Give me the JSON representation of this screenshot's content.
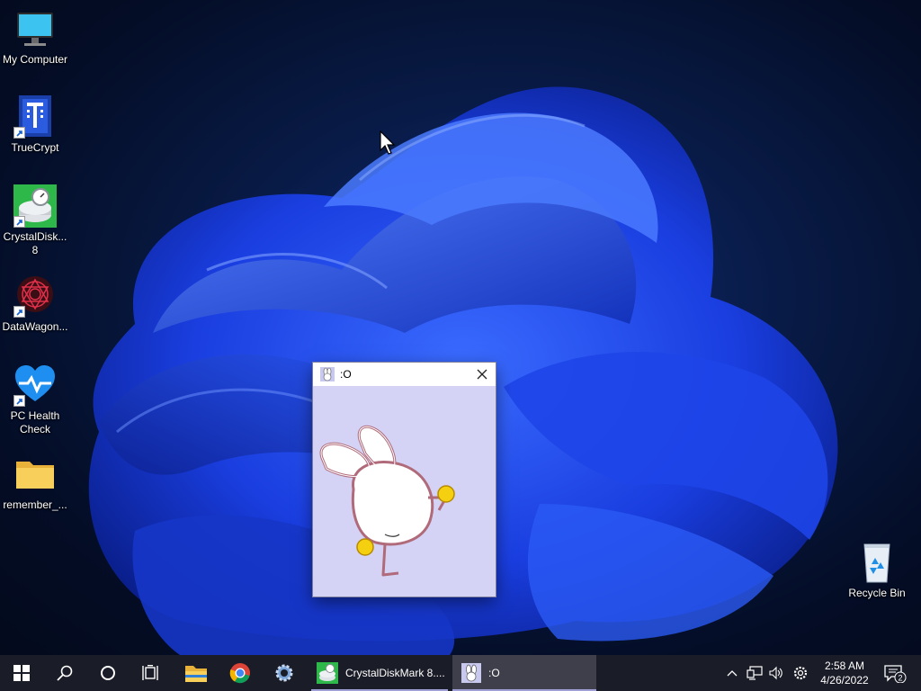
{
  "desktop": {
    "icons": [
      {
        "label": "My Computer",
        "icon": "monitor-icon"
      },
      {
        "label": "TrueCrypt",
        "icon": "truecrypt-icon"
      },
      {
        "label": "CrystalDisk... 8",
        "icon": "crystaldiskmark-icon"
      },
      {
        "label": "DataWagon...",
        "icon": "datawagon-icon"
      },
      {
        "label": "PC Health Check",
        "icon": "pc-health-icon"
      },
      {
        "label": "remember_...",
        "icon": "folder-icon"
      },
      {
        "label": "Recycle Bin",
        "icon": "recycle-bin-icon"
      }
    ]
  },
  "popup": {
    "title": ":O",
    "background_color": "#d4d3f5"
  },
  "taskbar": {
    "pinned": [
      "start-icon",
      "search-icon",
      "cortana-icon",
      "task-view-icon",
      "file-explorer-icon",
      "chrome-icon",
      "settings-gear-icon"
    ],
    "tasks": [
      {
        "label": "CrystalDiskMark 8....",
        "icon": "crystaldiskmark-icon"
      },
      {
        "label": ":O",
        "icon": "bunny-icon"
      }
    ],
    "tray": [
      "chevron-up-icon",
      "network-icon",
      "volume-icon",
      "gear-icon"
    ],
    "clock": {
      "time": "2:58 AM",
      "date": "4/26/2022"
    },
    "notification_count": "2"
  },
  "colors": {
    "taskbar_bg": "#1a1c27",
    "accent": "#9f9fd6",
    "wallpaper_blue": "#1f4fff"
  }
}
